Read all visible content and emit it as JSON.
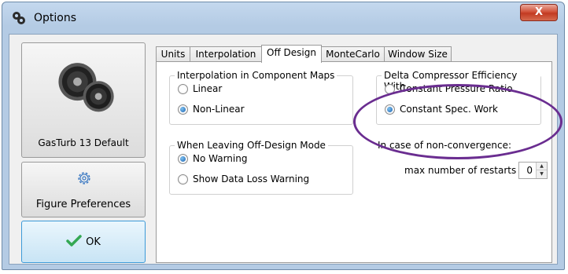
{
  "window": {
    "title": "Options",
    "close_label": "X"
  },
  "left_panel": {
    "default_button_label": "GasTurb 13 Default",
    "figure_button_label": "Figure Preferences",
    "ok_button_label": "OK"
  },
  "tabs": [
    {
      "label": "Units"
    },
    {
      "label": "Interpolation"
    },
    {
      "label": "Off Design"
    },
    {
      "label": "MonteCarlo"
    },
    {
      "label": "Window Size"
    }
  ],
  "active_tab": "Off Design",
  "interp_group": {
    "title": "Interpolation in Component Maps",
    "options": [
      {
        "label": "Linear",
        "checked": false
      },
      {
        "label": "Non-Linear",
        "checked": true
      }
    ]
  },
  "leave_group": {
    "title": "When Leaving Off-Design Mode",
    "options": [
      {
        "label": "No Warning",
        "checked": true
      },
      {
        "label": "Show Data Loss Warning",
        "checked": false
      }
    ]
  },
  "delta_group": {
    "title": "Delta Compressor Efficiency With",
    "options": [
      {
        "label": "Constant Pressure Ratio",
        "checked": false
      },
      {
        "label": "Constant Spec. Work",
        "checked": true
      }
    ]
  },
  "convergence": {
    "heading": "In case of non-convergence:",
    "restarts_label": "max number of restarts",
    "restarts_value": "0"
  },
  "icons": {
    "app": "gears-icon",
    "default_button": "turbofan-engines-icon",
    "figure_button": "gear-icon",
    "ok_button": "checkmark-icon"
  },
  "colors": {
    "annotation": "#6a2d90",
    "check": "#34a853",
    "radio_checked": "#1b62b0"
  }
}
